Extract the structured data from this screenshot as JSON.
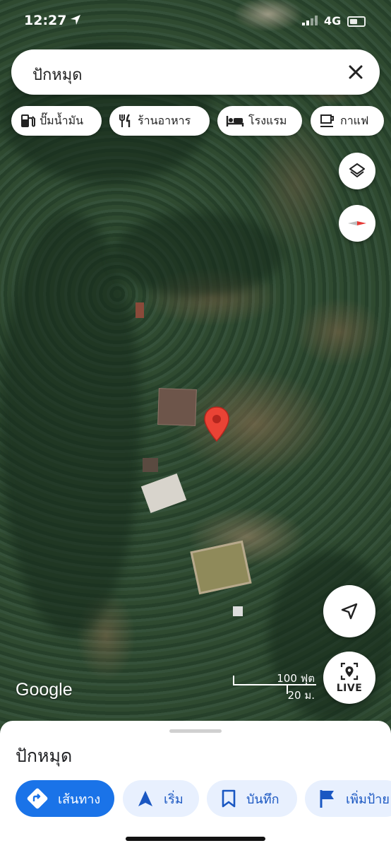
{
  "status_bar": {
    "time": "12:27",
    "network": "4G"
  },
  "search": {
    "query": "ปักหมุด"
  },
  "chips": [
    {
      "label": "ปั๊มน้ำมัน",
      "icon": "gas-station-icon"
    },
    {
      "label": "ร้านอาหาร",
      "icon": "restaurant-icon"
    },
    {
      "label": "โรงแรม",
      "icon": "hotel-icon"
    },
    {
      "label": "กาแฟ",
      "icon": "coffee-icon"
    }
  ],
  "map": {
    "attribution": "Google",
    "scale": {
      "feet": "100 ฟุต",
      "meters": "20 ม."
    },
    "live_label": "LIVE",
    "pin_color": "#ea4335"
  },
  "sheet": {
    "title": "ปักหมุด",
    "actions": [
      {
        "label": "เส้นทาง",
        "icon": "directions-icon"
      },
      {
        "label": "เริ่ม",
        "icon": "navigation-arrow-icon"
      },
      {
        "label": "บันทึก",
        "icon": "bookmark-icon"
      },
      {
        "label": "เพิ่มป้าย",
        "icon": "flag-icon"
      }
    ]
  },
  "colors": {
    "accent": "#1a73e8",
    "accent_light": "#e8f0fe"
  }
}
